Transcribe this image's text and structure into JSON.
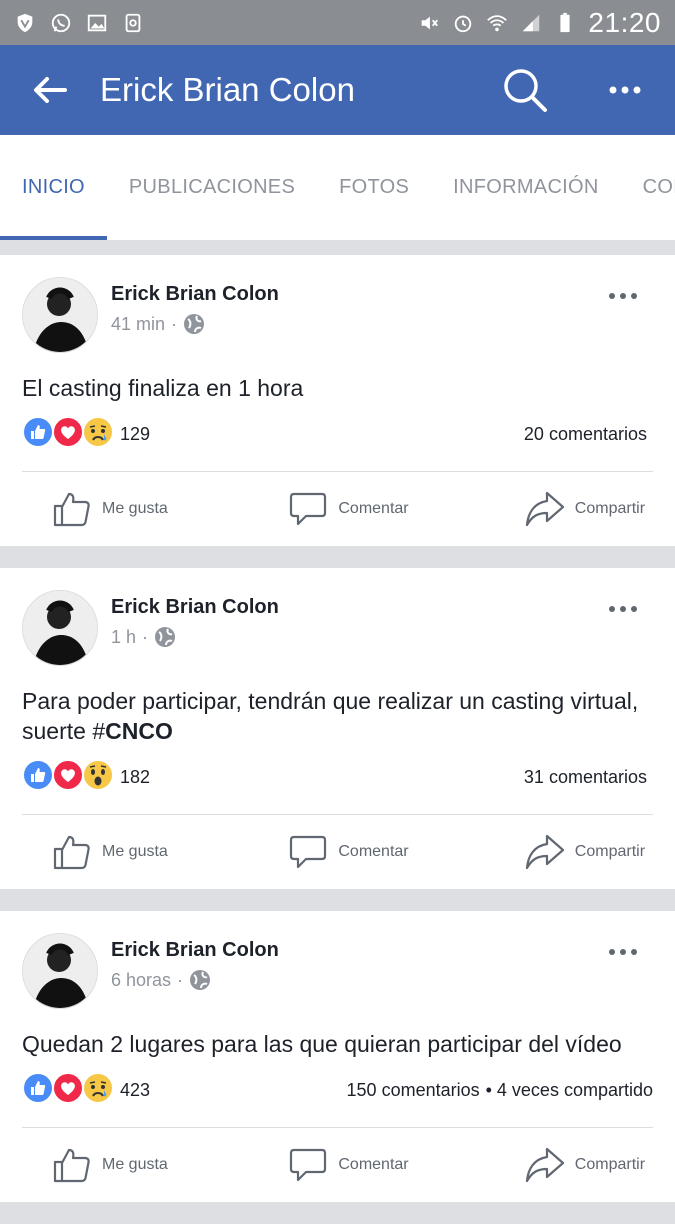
{
  "status_bar": {
    "time": "21:20"
  },
  "app_bar": {
    "title": "Erick Brian Colon"
  },
  "tabs": [
    {
      "label": "INICIO",
      "active": true
    },
    {
      "label": "PUBLICACIONES",
      "active": false
    },
    {
      "label": "FOTOS",
      "active": false
    },
    {
      "label": "INFORMACIÓN",
      "active": false
    },
    {
      "label": "COMU",
      "active": false
    }
  ],
  "posts": [
    {
      "author": "Erick Brian Colon",
      "time": "41 min",
      "text": "El casting finaliza en 1 hora",
      "text_suffix": "",
      "reactions": [
        "like",
        "love",
        "sad"
      ],
      "reaction_count": "129",
      "comments": "20 comentarios",
      "shares": ""
    },
    {
      "author": "Erick Brian Colon",
      "time": "1 h",
      "text": "Para poder participar, tendrán que realizar un casting virtual, suerte #",
      "text_suffix": "CNCO",
      "reactions": [
        "like",
        "love",
        "wow"
      ],
      "reaction_count": "182",
      "comments": "31 comentarios",
      "shares": ""
    },
    {
      "author": "Erick Brian Colon",
      "time": "6 horas",
      "text": "Quedan 2 lugares para las que quieran participar del vídeo",
      "text_suffix": "",
      "reactions": [
        "like",
        "love",
        "sad"
      ],
      "reaction_count": "423",
      "comments": "150 comentarios",
      "shares": "• 4 veces compartido"
    }
  ],
  "actions": {
    "like": "Me gusta",
    "comment": "Comentar",
    "share": "Compartir"
  },
  "colors": {
    "brand": "#4267b2",
    "status_bar": "#8a8d91",
    "separator": "#dddfe2"
  }
}
